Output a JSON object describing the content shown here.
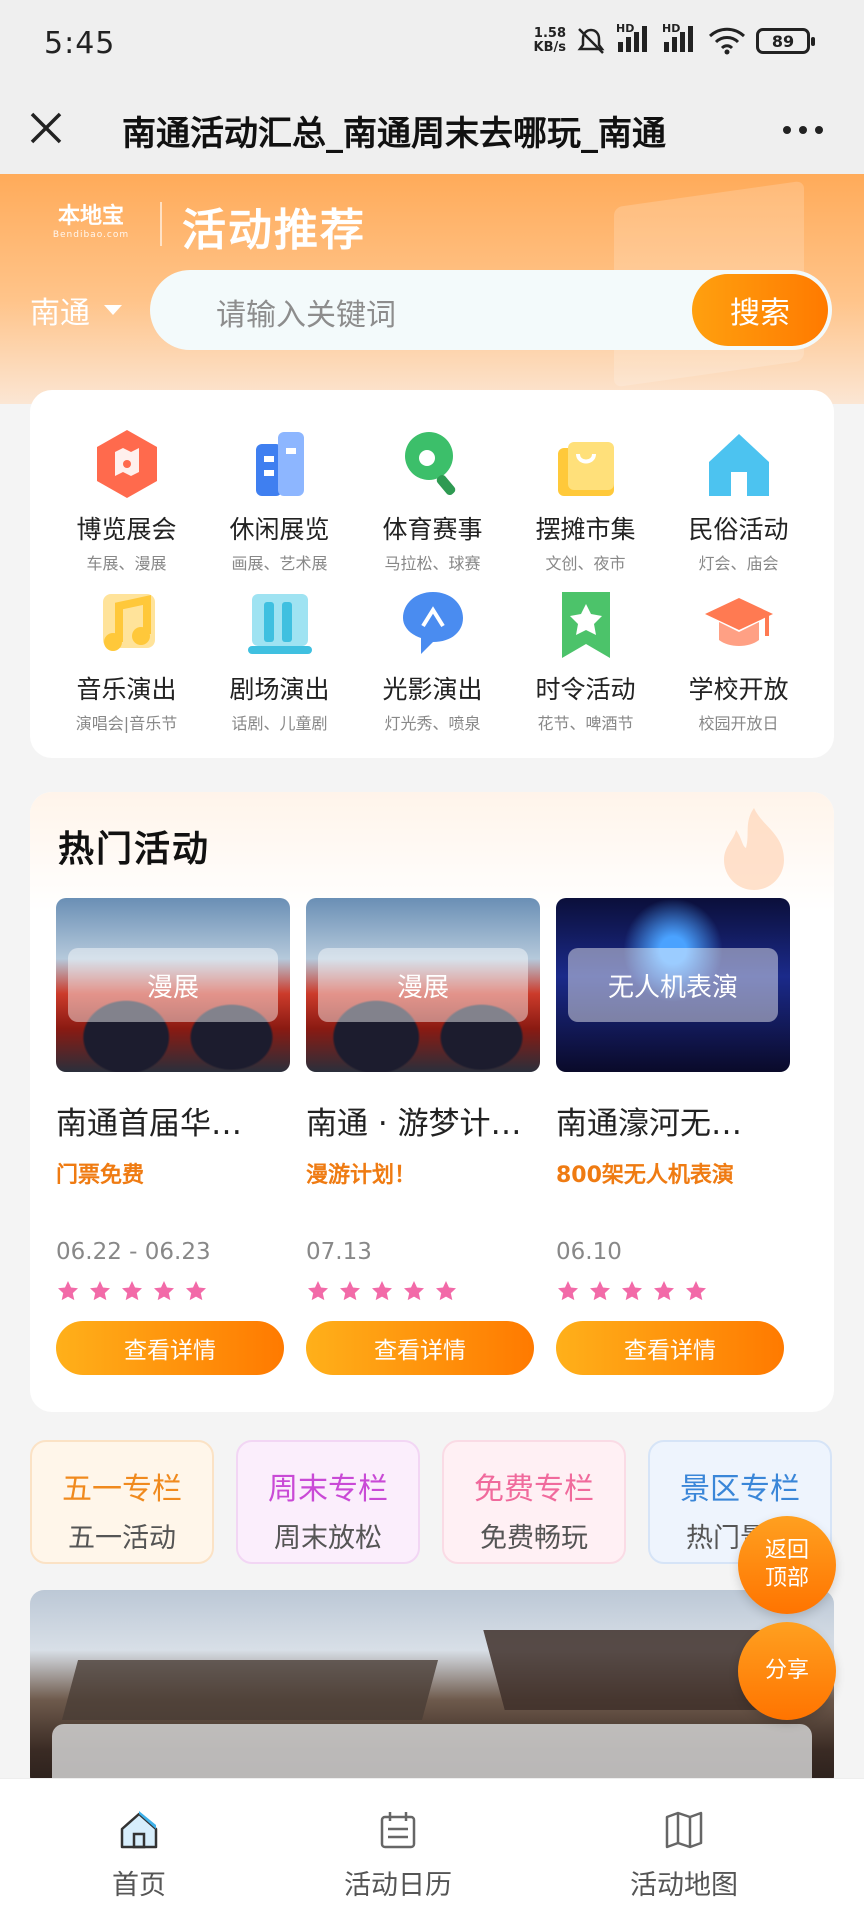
{
  "status_bar": {
    "time": "5:45",
    "net_speed": "1.58",
    "net_unit": "KB/s",
    "signal1_label": "HD",
    "signal2_label": "HD",
    "battery": "89"
  },
  "title_bar": {
    "title": "南通活动汇总_南通周末去哪玩_南通"
  },
  "hero": {
    "logo_main": "本地宝",
    "logo_sub": "Bendibao.com",
    "title": "活动推荐",
    "city": "南通",
    "search_placeholder": "请输入关键词",
    "search_button": "搜索"
  },
  "categories": [
    {
      "label": "博览展会",
      "sub": "车展、漫展",
      "icon": "map-hexagon-icon",
      "color": "#ff6a4d"
    },
    {
      "label": "休闲展览",
      "sub": "画展、艺术展",
      "icon": "building-icon",
      "color": "#3f7ff0"
    },
    {
      "label": "体育赛事",
      "sub": "马拉松、球赛",
      "icon": "ping-pong-icon",
      "color": "#3cbf6a"
    },
    {
      "label": "摆摊市集",
      "sub": "文创、夜市",
      "icon": "shopping-bag-icon",
      "color": "#ffc93a"
    },
    {
      "label": "民俗活动",
      "sub": "灯会、庙会",
      "icon": "house-icon",
      "color": "#4cc3f0"
    },
    {
      "label": "音乐演出",
      "sub": "演唱会|音乐节",
      "icon": "music-note-icon",
      "color": "#ffc83a"
    },
    {
      "label": "剧场演出",
      "sub": "话剧、儿童剧",
      "icon": "theater-icon",
      "color": "#3fc0e0"
    },
    {
      "label": "光影演出",
      "sub": "灯光秀、喷泉",
      "icon": "light-show-icon",
      "color": "#4a8cf0"
    },
    {
      "label": "时令活动",
      "sub": "花节、啤酒节",
      "icon": "star-bookmark-icon",
      "color": "#4cc36a"
    },
    {
      "label": "学校开放",
      "sub": "校园开放日",
      "icon": "graduation-cap-icon",
      "color": "#ff7a52"
    }
  ],
  "hot": {
    "title": "热门活动",
    "items": [
      {
        "tag": "漫展",
        "name": "南通首届华…",
        "desc": "门票免费",
        "date": "06.22 - 06.23",
        "rating": 5,
        "button": "查看详情"
      },
      {
        "tag": "漫展",
        "name": "南通 · 游梦计…",
        "desc": "漫游计划！",
        "date": "07.13",
        "rating": 5,
        "button": "查看详情"
      },
      {
        "tag": "无人机表演",
        "name": "南通濠河无…",
        "desc": "800架无人机表演",
        "date": "06.10",
        "rating": 5,
        "button": "查看详情"
      }
    ]
  },
  "columns": [
    {
      "title": "五一专栏",
      "sub": "五一活动",
      "color": "#f08a1e",
      "bg": "#fff6ea",
      "border": "#fbe2c5"
    },
    {
      "title": "周末专栏",
      "sub": "周末放松",
      "color": "#c94ad6",
      "bg": "#fbeefc",
      "border": "#f2d6f4"
    },
    {
      "title": "免费专栏",
      "sub": "免费畅玩",
      "color": "#f06a9c",
      "bg": "#fff0f4",
      "border": "#fadbe5"
    },
    {
      "title": "景区专栏",
      "sub": "热门景区",
      "color": "#3a86d8",
      "bg": "#eef4fd",
      "border": "#d6e4f7"
    }
  ],
  "floating": {
    "back_top": "返回\n顶部",
    "share": "分享"
  },
  "tabs": [
    {
      "label": "首页",
      "icon": "home-icon"
    },
    {
      "label": "活动日历",
      "icon": "calendar-icon"
    },
    {
      "label": "活动地图",
      "icon": "map-icon"
    }
  ]
}
